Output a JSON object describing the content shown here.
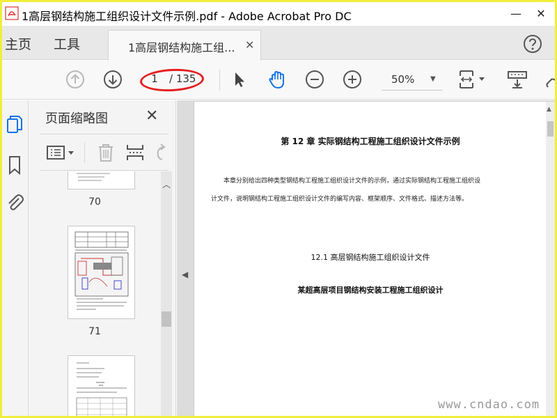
{
  "window": {
    "title": "1高层钢结构施工组织设计文件示例.pdf - Adobe Acrobat Pro DC",
    "minimize": "—",
    "close": "✕"
  },
  "tabs": {
    "home": "主页",
    "tools": "工具",
    "document": "1高层钢结构施工组...",
    "document_close": "✕"
  },
  "toolbar": {
    "page_current": "1",
    "page_total": "/ 135",
    "zoom": "50%"
  },
  "thumbnails_pane": {
    "title": "页面缩略图",
    "close": "✕",
    "pages": [
      "70",
      "71"
    ]
  },
  "document": {
    "chapter_title": "第 12 章  实际钢结构工程施工组织设计文件示例",
    "intro_line1": "本章分别给出四种类型钢结构工程施工组织设计文件的示例，通过实际钢结构工程施工组织设",
    "intro_line2": "计文件，说明钢结构工程施工组织设计文件的编写内容、框架顺序、文件格式、描述方法等。",
    "section_title": "12.1 高层钢结构施工组织设计文件",
    "subsection_title": "某超高层项目钢结构安装工程施工组织设计"
  },
  "watermark": "www.cndao.com",
  "colors": {
    "frame_border": "#f0ee3a",
    "annotation_ellipse": "#e61e1e",
    "active_icon_blue": "#1473e6"
  }
}
